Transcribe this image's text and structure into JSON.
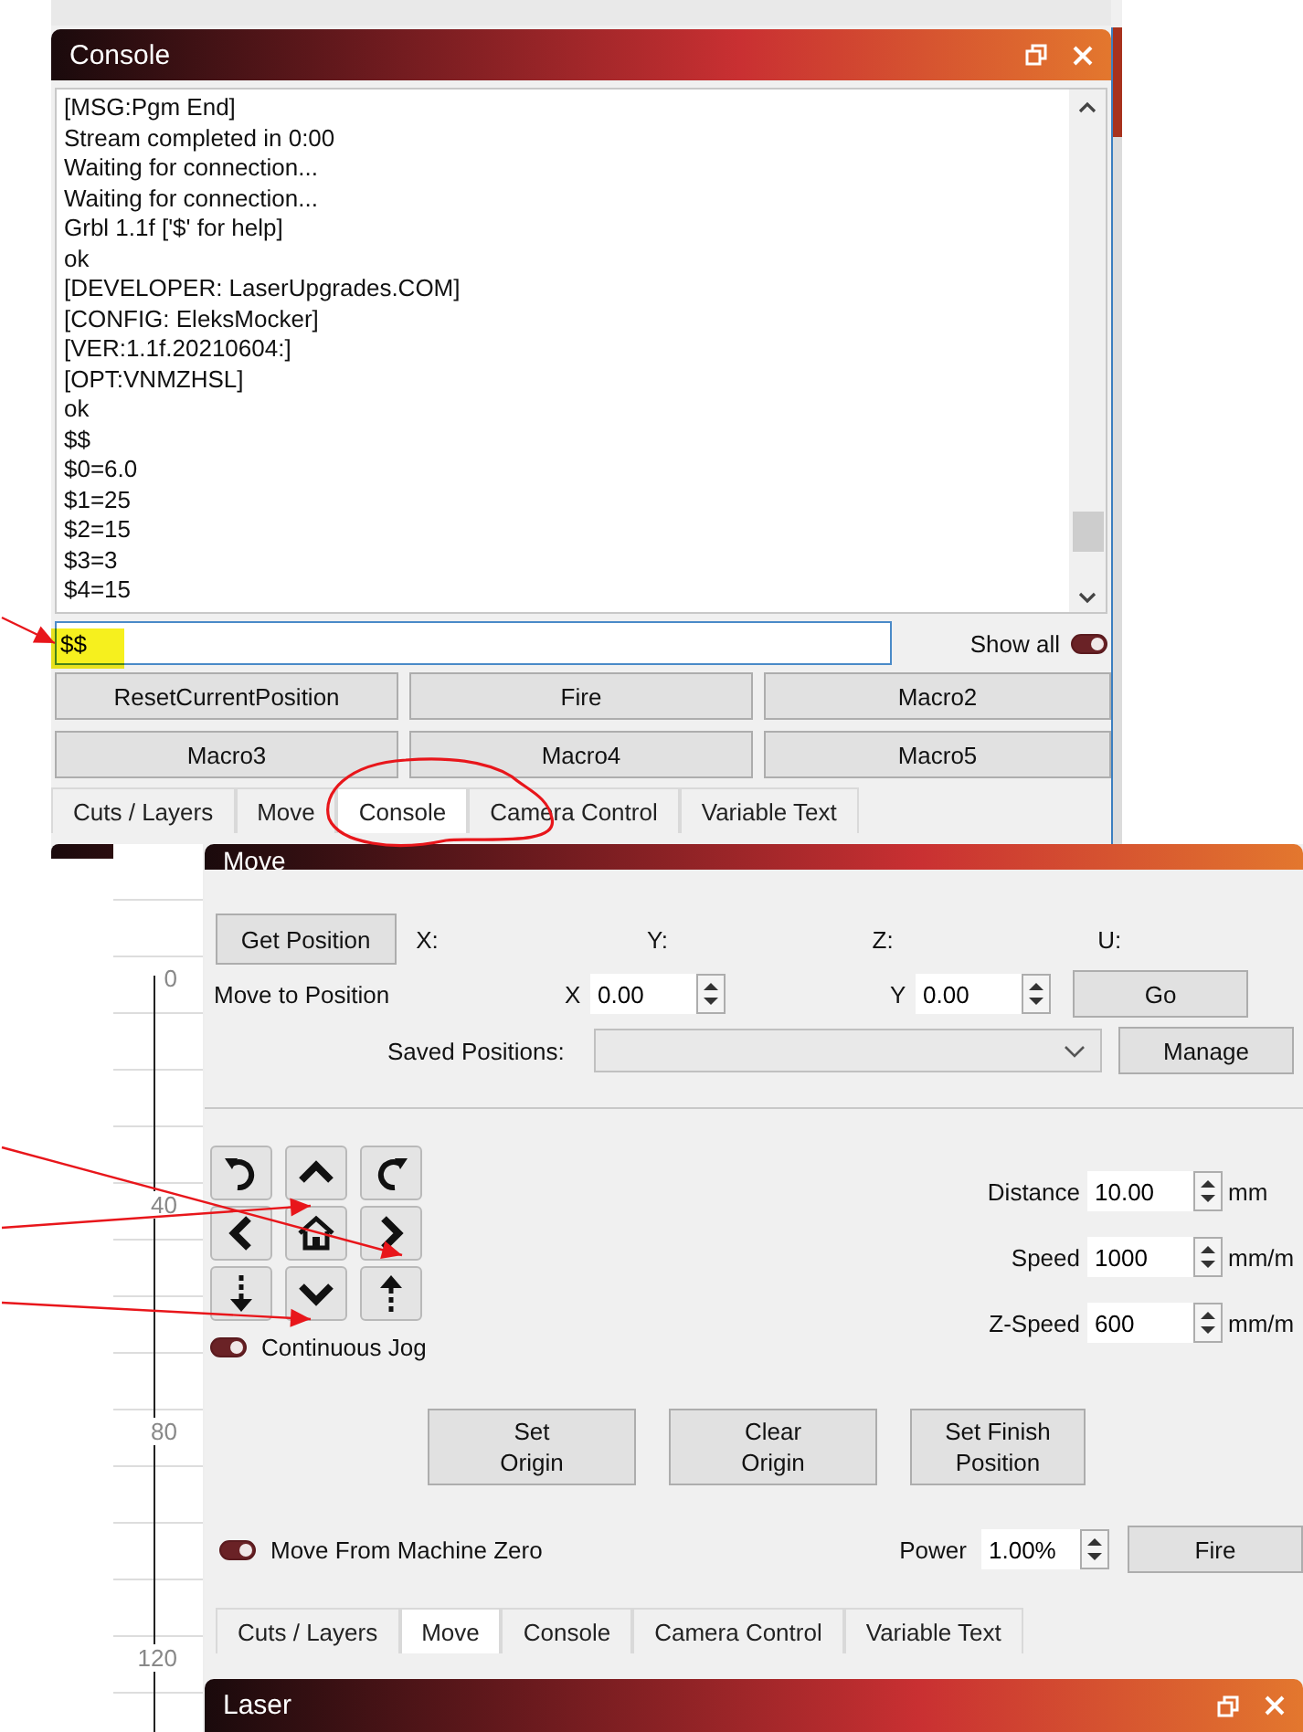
{
  "console_panel": {
    "title": "Console",
    "lines": [
      "[MSG:Pgm End]",
      "Stream completed in 0:00",
      "Waiting for connection...",
      "Waiting for connection...",
      "Grbl 1.1f ['$' for help]",
      "ok",
      "[DEVELOPER: LaserUpgrades.COM]",
      "[CONFIG: EleksMocker]",
      "[VER:1.1f.20210604:]",
      "[OPT:VNMZHSL]",
      "ok",
      "$$",
      "$0=6.0",
      "$1=25",
      "$2=15",
      "$3=3",
      "$4=15"
    ],
    "command": "$$",
    "show_all": {
      "label": "Show all",
      "on": true
    },
    "macros": [
      "ResetCurrentPosition",
      "Fire",
      "Macro2",
      "Macro3",
      "Macro4",
      "Macro5"
    ],
    "tabs": [
      {
        "label": "Cuts / Layers",
        "selected": false
      },
      {
        "label": "Move",
        "selected": false
      },
      {
        "label": "Console",
        "selected": true
      },
      {
        "label": "Camera Control",
        "selected": false
      },
      {
        "label": "Variable Text",
        "selected": false
      }
    ]
  },
  "ruler": {
    "ticks": [
      "0",
      "40",
      "80",
      "120"
    ]
  },
  "move_panel": {
    "title": "Move",
    "get_position": "Get Position",
    "axes": [
      "X:",
      "Y:",
      "Z:",
      "U:"
    ],
    "move_to": {
      "label": "Move to Position",
      "x_label": "X",
      "x_value": "0.00",
      "y_label": "Y",
      "y_value": "0.00",
      "go": "Go"
    },
    "saved_positions": {
      "label": "Saved Positions:",
      "manage": "Manage"
    },
    "jog_buttons": [
      {
        "kind": "rotate-left"
      },
      {
        "kind": "up"
      },
      {
        "kind": "rotate-right"
      },
      {
        "kind": "left"
      },
      {
        "kind": "home"
      },
      {
        "kind": "right"
      },
      {
        "kind": "z-down"
      },
      {
        "kind": "down"
      },
      {
        "kind": "z-up"
      }
    ],
    "continuous_jog": {
      "label": "Continuous Jog",
      "on": true
    },
    "settings": [
      {
        "label": "Distance",
        "value": "10.00",
        "unit": "mm"
      },
      {
        "label": "Speed",
        "value": "1000",
        "unit": "mm/m"
      },
      {
        "label": "Z-Speed",
        "value": "600",
        "unit": "mm/m"
      }
    ],
    "origin_buttons": [
      "Set\nOrigin",
      "Clear\nOrigin",
      "Set Finish\nPosition"
    ],
    "move_from_zero": {
      "label": "Move From Machine Zero",
      "on": true
    },
    "power": {
      "label": "Power",
      "value": "1.00%"
    },
    "fire": "Fire",
    "tabs": [
      {
        "label": "Cuts / Layers",
        "selected": false
      },
      {
        "label": "Move",
        "selected": true
      },
      {
        "label": "Console",
        "selected": false
      },
      {
        "label": "Camera Control",
        "selected": false
      },
      {
        "label": "Variable Text",
        "selected": false
      }
    ]
  },
  "laser_panel": {
    "title": "Laser"
  }
}
